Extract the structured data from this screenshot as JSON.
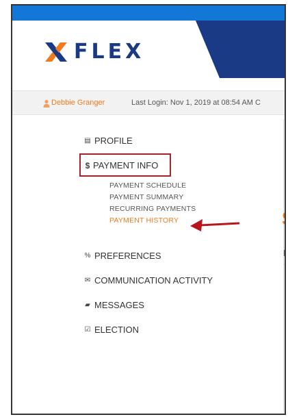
{
  "brand": {
    "logo_text": "FLEX",
    "colors": {
      "topbar": "#1277d6",
      "navy": "#1a3a86",
      "orange": "#f07b1c",
      "highlight_box": "#a8202a",
      "arrow": "#b8141c"
    }
  },
  "login_bar": {
    "user_icon": "user-icon",
    "user_name": "Debbie Granger",
    "last_login": "Last Login: Nov 1, 2019 at 08:54 AM C"
  },
  "sidebar": {
    "items": [
      {
        "icon": "id-card-icon",
        "icon_glyph": "▤",
        "label": "PROFILE"
      },
      {
        "icon": "dollar-icon",
        "icon_glyph": "$",
        "label": "PAYMENT INFO"
      },
      {
        "icon": "percent-icon",
        "icon_glyph": "%",
        "label": "PREFERENCES"
      },
      {
        "icon": "envelope-icon",
        "icon_glyph": "✉",
        "label": "COMMUNICATION ACTIVITY"
      },
      {
        "icon": "speech-bubble-icon",
        "icon_glyph": "▰",
        "label": "MESSAGES"
      },
      {
        "icon": "checkbox-icon",
        "icon_glyph": "☑",
        "label": "ELECTION"
      }
    ],
    "payment_subitems": [
      {
        "label": "PAYMENT SCHEDULE",
        "active": false
      },
      {
        "label": "PAYMENT SUMMARY",
        "active": false
      },
      {
        "label": "RECURRING PAYMENTS",
        "active": false
      },
      {
        "label": "PAYMENT HISTORY",
        "active": true
      }
    ]
  },
  "right_panel": {
    "fragment_heading": "S",
    "fragment_label": "P"
  }
}
